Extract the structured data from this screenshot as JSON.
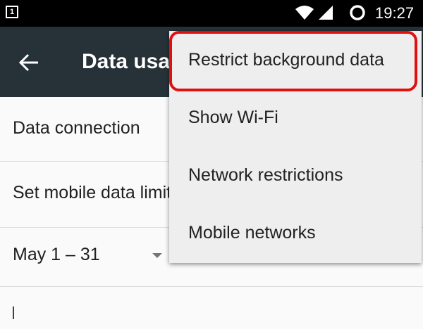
{
  "status_bar": {
    "notification_icon": "notification-icon",
    "notification_glyph": "1",
    "time": "19:27"
  },
  "app_bar": {
    "title": "Data usage"
  },
  "list": {
    "data_connection_label": "Data connection",
    "mobile_limit_label": "Set mobile data limit",
    "cycle_label": "May 1 – 31"
  },
  "menu": {
    "items": [
      {
        "label": "Restrict background data"
      },
      {
        "label": "Show Wi-Fi"
      },
      {
        "label": "Network restrictions"
      },
      {
        "label": "Mobile networks"
      }
    ]
  },
  "colors": {
    "status_bar": "#000000",
    "app_bar": "#263238",
    "menu_bg": "#eeeeee",
    "highlight": "#e01010"
  }
}
